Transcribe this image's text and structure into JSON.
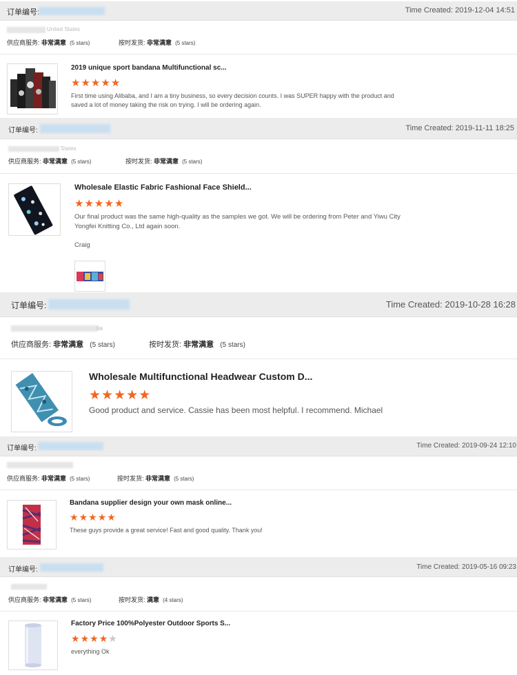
{
  "reviews": [
    {
      "order_label": "订单编号:",
      "time": "Time Created: 2019-12-04 14:51",
      "country": "United States",
      "supplier_service_label": "供应商服务:",
      "supplier_service_value": "非常满意",
      "supplier_service_stars": "(5 stars)",
      "ontime_label": "按时发货:",
      "ontime_value": "非常满意",
      "ontime_stars": "(5 stars)",
      "product_title": "2019 unique sport bandana Multifunctional sc...",
      "rating": 5,
      "comment": "First time using Alibaba, and I am a tiny business, so every decision counts.  I was SUPER happy with the product and saved a lot of money taking the risk on trying. I will be ordering again."
    },
    {
      "order_label": "订单编号:",
      "time": "Time Created: 2019-11-11 18:25",
      "country": "States",
      "supplier_service_label": "供应商服务:",
      "supplier_service_value": "非常满意",
      "supplier_service_stars": "(5 stars)",
      "ontime_label": "按时发货:",
      "ontime_value": "非常满意",
      "ontime_stars": "(5 stars)",
      "product_title": "Wholesale Elastic Fabric Fashional Face Shield...",
      "rating": 5,
      "comment": "Our final product was the same high-quality as the samples we got. We will be ordering from Peter and Yiwu City Yongfei Knitting Co., Ltd again soon.",
      "signature": "Craig"
    },
    {
      "order_label": "订单编号:",
      "time": "Time Created: 2019-10-28 16:28",
      "country": "lia",
      "supplier_service_label": "供应商服务:",
      "supplier_service_value": "非常满意",
      "supplier_service_stars": "(5 stars)",
      "ontime_label": "按时发货:",
      "ontime_value": "非常满意",
      "ontime_stars": "(5 stars)",
      "product_title": "Wholesale Multifunctional Headwear Custom D...",
      "rating": 5,
      "comment": "Good product and service. Cassie has been most helpful. I recommend. Michael"
    },
    {
      "order_label": "订单编号:",
      "time": "Time Created: 2019-09-24 12:10",
      "country": "",
      "supplier_service_label": "供应商服务:",
      "supplier_service_value": "非常满意",
      "supplier_service_stars": "(5 stars)",
      "ontime_label": "按时发货:",
      "ontime_value": "非常满意",
      "ontime_stars": "(5 stars)",
      "product_title": "Bandana supplier design your own mask online...",
      "rating": 5,
      "comment": "These guys provide a great service!  Fast and good quality.  Thank you!"
    },
    {
      "order_label": "订单编号:",
      "time": "Time Created: 2019-05-16 09:23",
      "country": "",
      "supplier_service_label": "供应商服务:",
      "supplier_service_value": "非常满意",
      "supplier_service_stars": "(5 stars)",
      "ontime_label": "按时发货:",
      "ontime_value": "满意",
      "ontime_stars": "(4 stars)",
      "product_title": "Factory Price 100%Polyester Outdoor Sports S...",
      "rating": 4,
      "comment": "everything Ok"
    }
  ],
  "colors": {
    "star": "#f26522",
    "star_off": "#c8c8c8",
    "header_bg": "#ececec"
  }
}
